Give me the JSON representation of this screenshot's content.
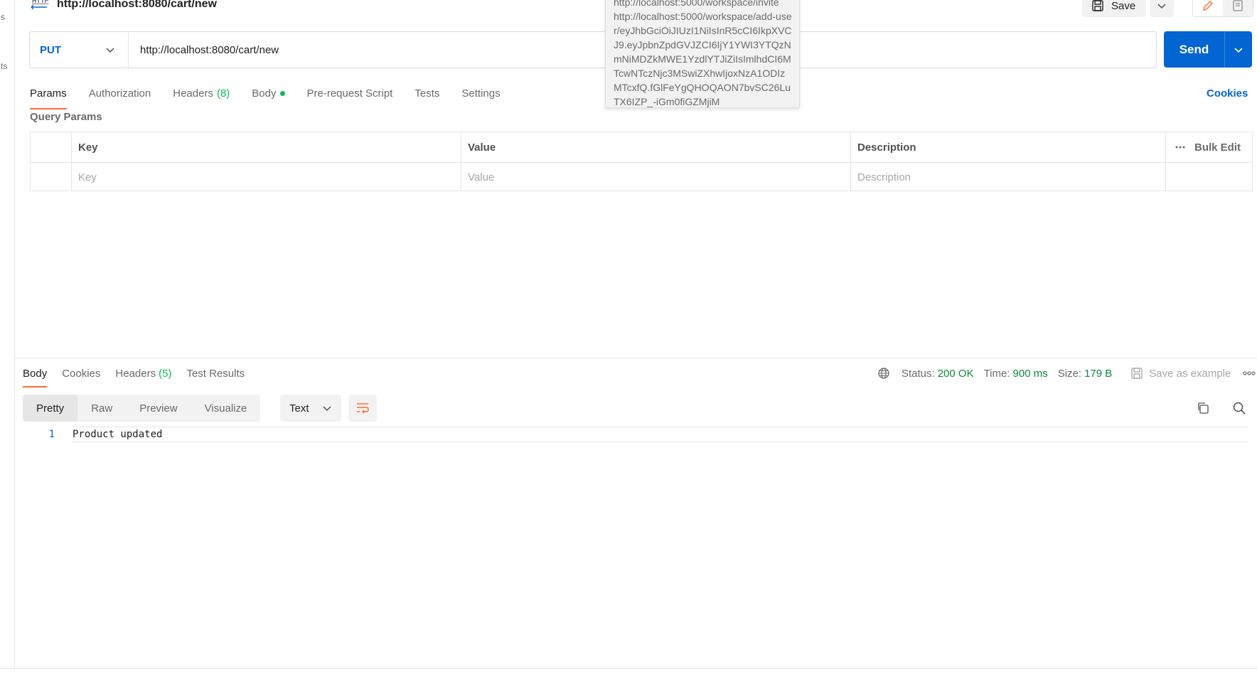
{
  "request": {
    "title": "http://localhost:8080/cart/new",
    "method": "PUT",
    "url": "http://localhost:8080/cart/new"
  },
  "toolbar": {
    "save_label": "Save",
    "send_label": "Send"
  },
  "left_strip": {
    "text_1": "s",
    "text_2": "ts"
  },
  "tooltip": {
    "clipped_line": "http://localhost:5000/workspace/invite",
    "text": "http://localhost:5000/workspace/add-user/eyJhbGciOiJIUzI1NiIsInR5cCI6IkpXVCJ9.eyJpbnZpdGVJZCI6IjY1YWI3YTQzNmNiMDZkMWE1YzdlYTJiZiIsImlhdCI6MTcwNTczNjc3MSwiZXhwIjoxNzA1ODIzMTcxfQ.fGlFeYgQHOQAON7bvSC26LuTX6IZP_-iGm0fiGZMjiM"
  },
  "request_tabs": {
    "params": "Params",
    "authorization": "Authorization",
    "headers": "Headers",
    "headers_count": "(8)",
    "body": "Body",
    "pre_request": "Pre-request Script",
    "tests": "Tests",
    "settings": "Settings",
    "cookies": "Cookies"
  },
  "query_params": {
    "label": "Query Params",
    "columns": {
      "key": "Key",
      "value": "Value",
      "description": "Description"
    },
    "bulk_edit": "Bulk Edit",
    "placeholders": {
      "key": "Key",
      "value": "Value",
      "description": "Description"
    }
  },
  "response_tabs": {
    "body": "Body",
    "cookies": "Cookies",
    "headers": "Headers",
    "headers_count": "(5)",
    "test_results": "Test Results"
  },
  "response_meta": {
    "status_label": "Status:",
    "status_value": "200 OK",
    "time_label": "Time:",
    "time_value": "900 ms",
    "size_label": "Size:",
    "size_value": "179 B",
    "save_example": "Save as example"
  },
  "view_modes": {
    "pretty": "Pretty",
    "raw": "Raw",
    "preview": "Preview",
    "visualize": "Visualize"
  },
  "format_select": {
    "selected": "Text"
  },
  "response_body": {
    "line_number": "1",
    "line_text": "Product updated"
  },
  "colors": {
    "accent": "#ff6c37",
    "primary": "#0265d2",
    "success": "#0cbb52"
  }
}
